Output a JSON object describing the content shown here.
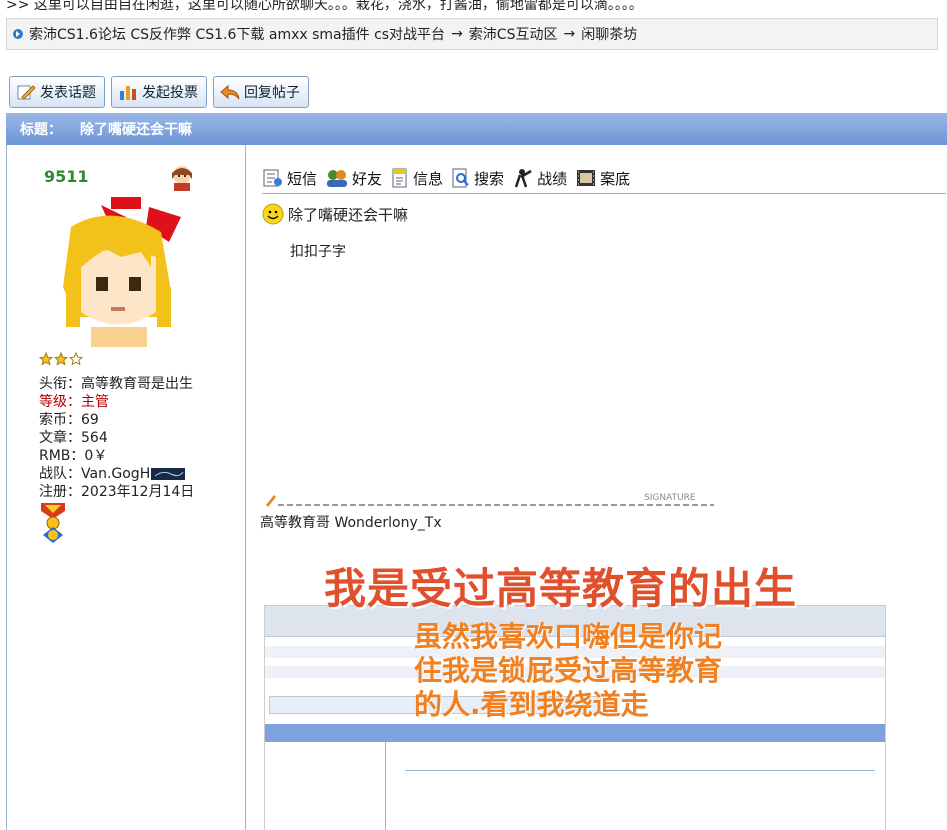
{
  "top_notice": ">> 这里可以自由自在闲逛，这里可以随心所欲聊天。。。栽花，浇水，打酱油，偷地雷都是可以滴。。。。",
  "breadcrumb": {
    "items": [
      "索沛CS1.6论坛 CS反作弊 CS1.6下载 amxx sma插件 cs对战平台",
      "→",
      "索沛CS互动区",
      "→",
      "闲聊茶坊"
    ]
  },
  "actions": {
    "new_topic": "发表话题",
    "new_poll": "发起投票",
    "reply": "回复帖子"
  },
  "thread": {
    "title_label": "标题：",
    "title": "除了嘴硬还会干嘛"
  },
  "author": {
    "name": "9511",
    "title_label": "头衔：",
    "title_value": "高等教育哥是出生",
    "level_label": "等级：",
    "level_value": "主管",
    "coins_label": "索币：",
    "coins_value": "69",
    "posts_label": "文章：",
    "posts_value": "564",
    "rmb_label": "RMB：",
    "rmb_value": "0￥",
    "team_label": "战队：",
    "team_value": "Van.GogH",
    "reg_label": "注册：",
    "reg_value": "2023年12月14日",
    "stars": 2,
    "stars_max": 3
  },
  "toolbar": {
    "msg": "短信",
    "friend": "好友",
    "info": "信息",
    "search": "搜索",
    "record": "战绩",
    "archive": "案底"
  },
  "post": {
    "title": "除了嘴硬还会干嘛",
    "body": "扣扣子字"
  },
  "signature": {
    "mark": "SIGNATURE",
    "text": "高等教育哥 Wonderlony_Tx",
    "image_caption1": "我是受过高等教育的出生",
    "image_caption2": "虽然我喜欢口嗨但是你记",
    "image_caption3": "住我是锁屁受过高等教育",
    "image_caption4": "的人.看到我绕道走"
  },
  "colors": {
    "title_bar": "#7fa2dc",
    "username": "#2e8b2e",
    "level": "#b00000",
    "border": "#9ab4d6"
  }
}
